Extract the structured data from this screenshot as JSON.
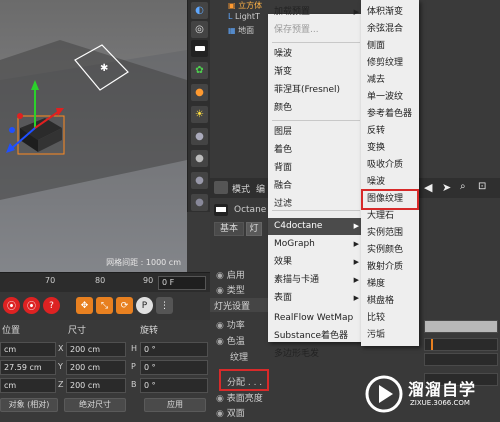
{
  "viewport": {
    "grid_info": "网格间距 : 1000 cm"
  },
  "object_manager": {
    "items": [
      "立方体",
      "LightT",
      "地面"
    ]
  },
  "timeline": {
    "ticks": [
      "70",
      "80",
      "90"
    ],
    "current_frame": "0 F"
  },
  "coords": {
    "headers": {
      "position": "位置",
      "size": "尺寸",
      "rotation": "旋转"
    },
    "rows": [
      {
        "pos": "cm",
        "size_axis": "X",
        "size": "200 cm",
        "rot_axis": "H",
        "rot": "0 °"
      },
      {
        "pos": "27.59 cm",
        "size_axis": "Y",
        "size": "200 cm",
        "rot_axis": "P",
        "rot": "0 °"
      },
      {
        "pos": "cm",
        "size_axis": "Z",
        "size": "200 cm",
        "rot_axis": "B",
        "rot": "0 °"
      }
    ],
    "mode_left": "对象 (相对)",
    "mode_right": "绝对尺寸",
    "apply": "应用"
  },
  "attr": {
    "tab_mode": "模式",
    "tab_edit": "编",
    "object_name": "Octane",
    "basic_tab": "基本",
    "light_tab": "灯",
    "rows": {
      "enable": "启用",
      "type": "类型",
      "light_settings": "灯光设置",
      "power": "功率",
      "color": "色温",
      "texture": "纹理",
      "distribution": "分配 . . .",
      "surface_brightness": "表面亮度",
      "double_sided": "双面"
    }
  },
  "menu_main": {
    "items": [
      {
        "label": "加载预置",
        "disabled": false,
        "submenu": true
      },
      {
        "label": "保存预置...",
        "disabled": true,
        "submenu": false
      },
      {
        "label": "噪波",
        "disabled": false,
        "submenu": false
      },
      {
        "label": "渐变",
        "disabled": false,
        "submenu": false
      },
      {
        "label": "菲涅耳(Fresnel)",
        "disabled": false,
        "submenu": false
      },
      {
        "label": "颜色",
        "disabled": false,
        "submenu": false
      },
      {
        "label": "图层",
        "disabled": false,
        "submenu": false
      },
      {
        "label": "着色",
        "disabled": false,
        "submenu": false
      },
      {
        "label": "背面",
        "disabled": false,
        "submenu": false
      },
      {
        "label": "融合",
        "disabled": false,
        "submenu": false
      },
      {
        "label": "过滤",
        "disabled": false,
        "submenu": false
      },
      {
        "label": "C4doctane",
        "disabled": false,
        "submenu": true
      },
      {
        "label": "MoGraph",
        "disabled": false,
        "submenu": true
      },
      {
        "label": "效果",
        "disabled": false,
        "submenu": true
      },
      {
        "label": "素描与卡通",
        "disabled": false,
        "submenu": true
      },
      {
        "label": "表面",
        "disabled": false,
        "submenu": true
      },
      {
        "label": "RealFlow WetMap",
        "disabled": false,
        "submenu": false
      },
      {
        "label": "Substance着色器",
        "disabled": false,
        "submenu": false
      },
      {
        "label": "多边形毛发",
        "disabled": false,
        "submenu": false
      }
    ]
  },
  "menu_sub": {
    "items": [
      "体积渐变",
      "余弦混合",
      "侧面",
      "修剪纹理",
      "减去",
      "单一波纹",
      "参考着色器",
      "反转",
      "变换",
      "吸收介质",
      "噪波",
      "图像纹理",
      "大理石",
      "实例范围",
      "实例颜色",
      "散射介质",
      "梯度",
      "棋盘格",
      "比较",
      "污垢"
    ],
    "highlighted": "图像纹理"
  },
  "watermark": {
    "brand": "溜溜自学",
    "url": "ZIXUE.3066.COM"
  },
  "colors": {
    "menu_bg": "#eeeeee",
    "highlight": "#4b4b4b",
    "red_box": "#d72a2a",
    "panel": "#393939"
  }
}
